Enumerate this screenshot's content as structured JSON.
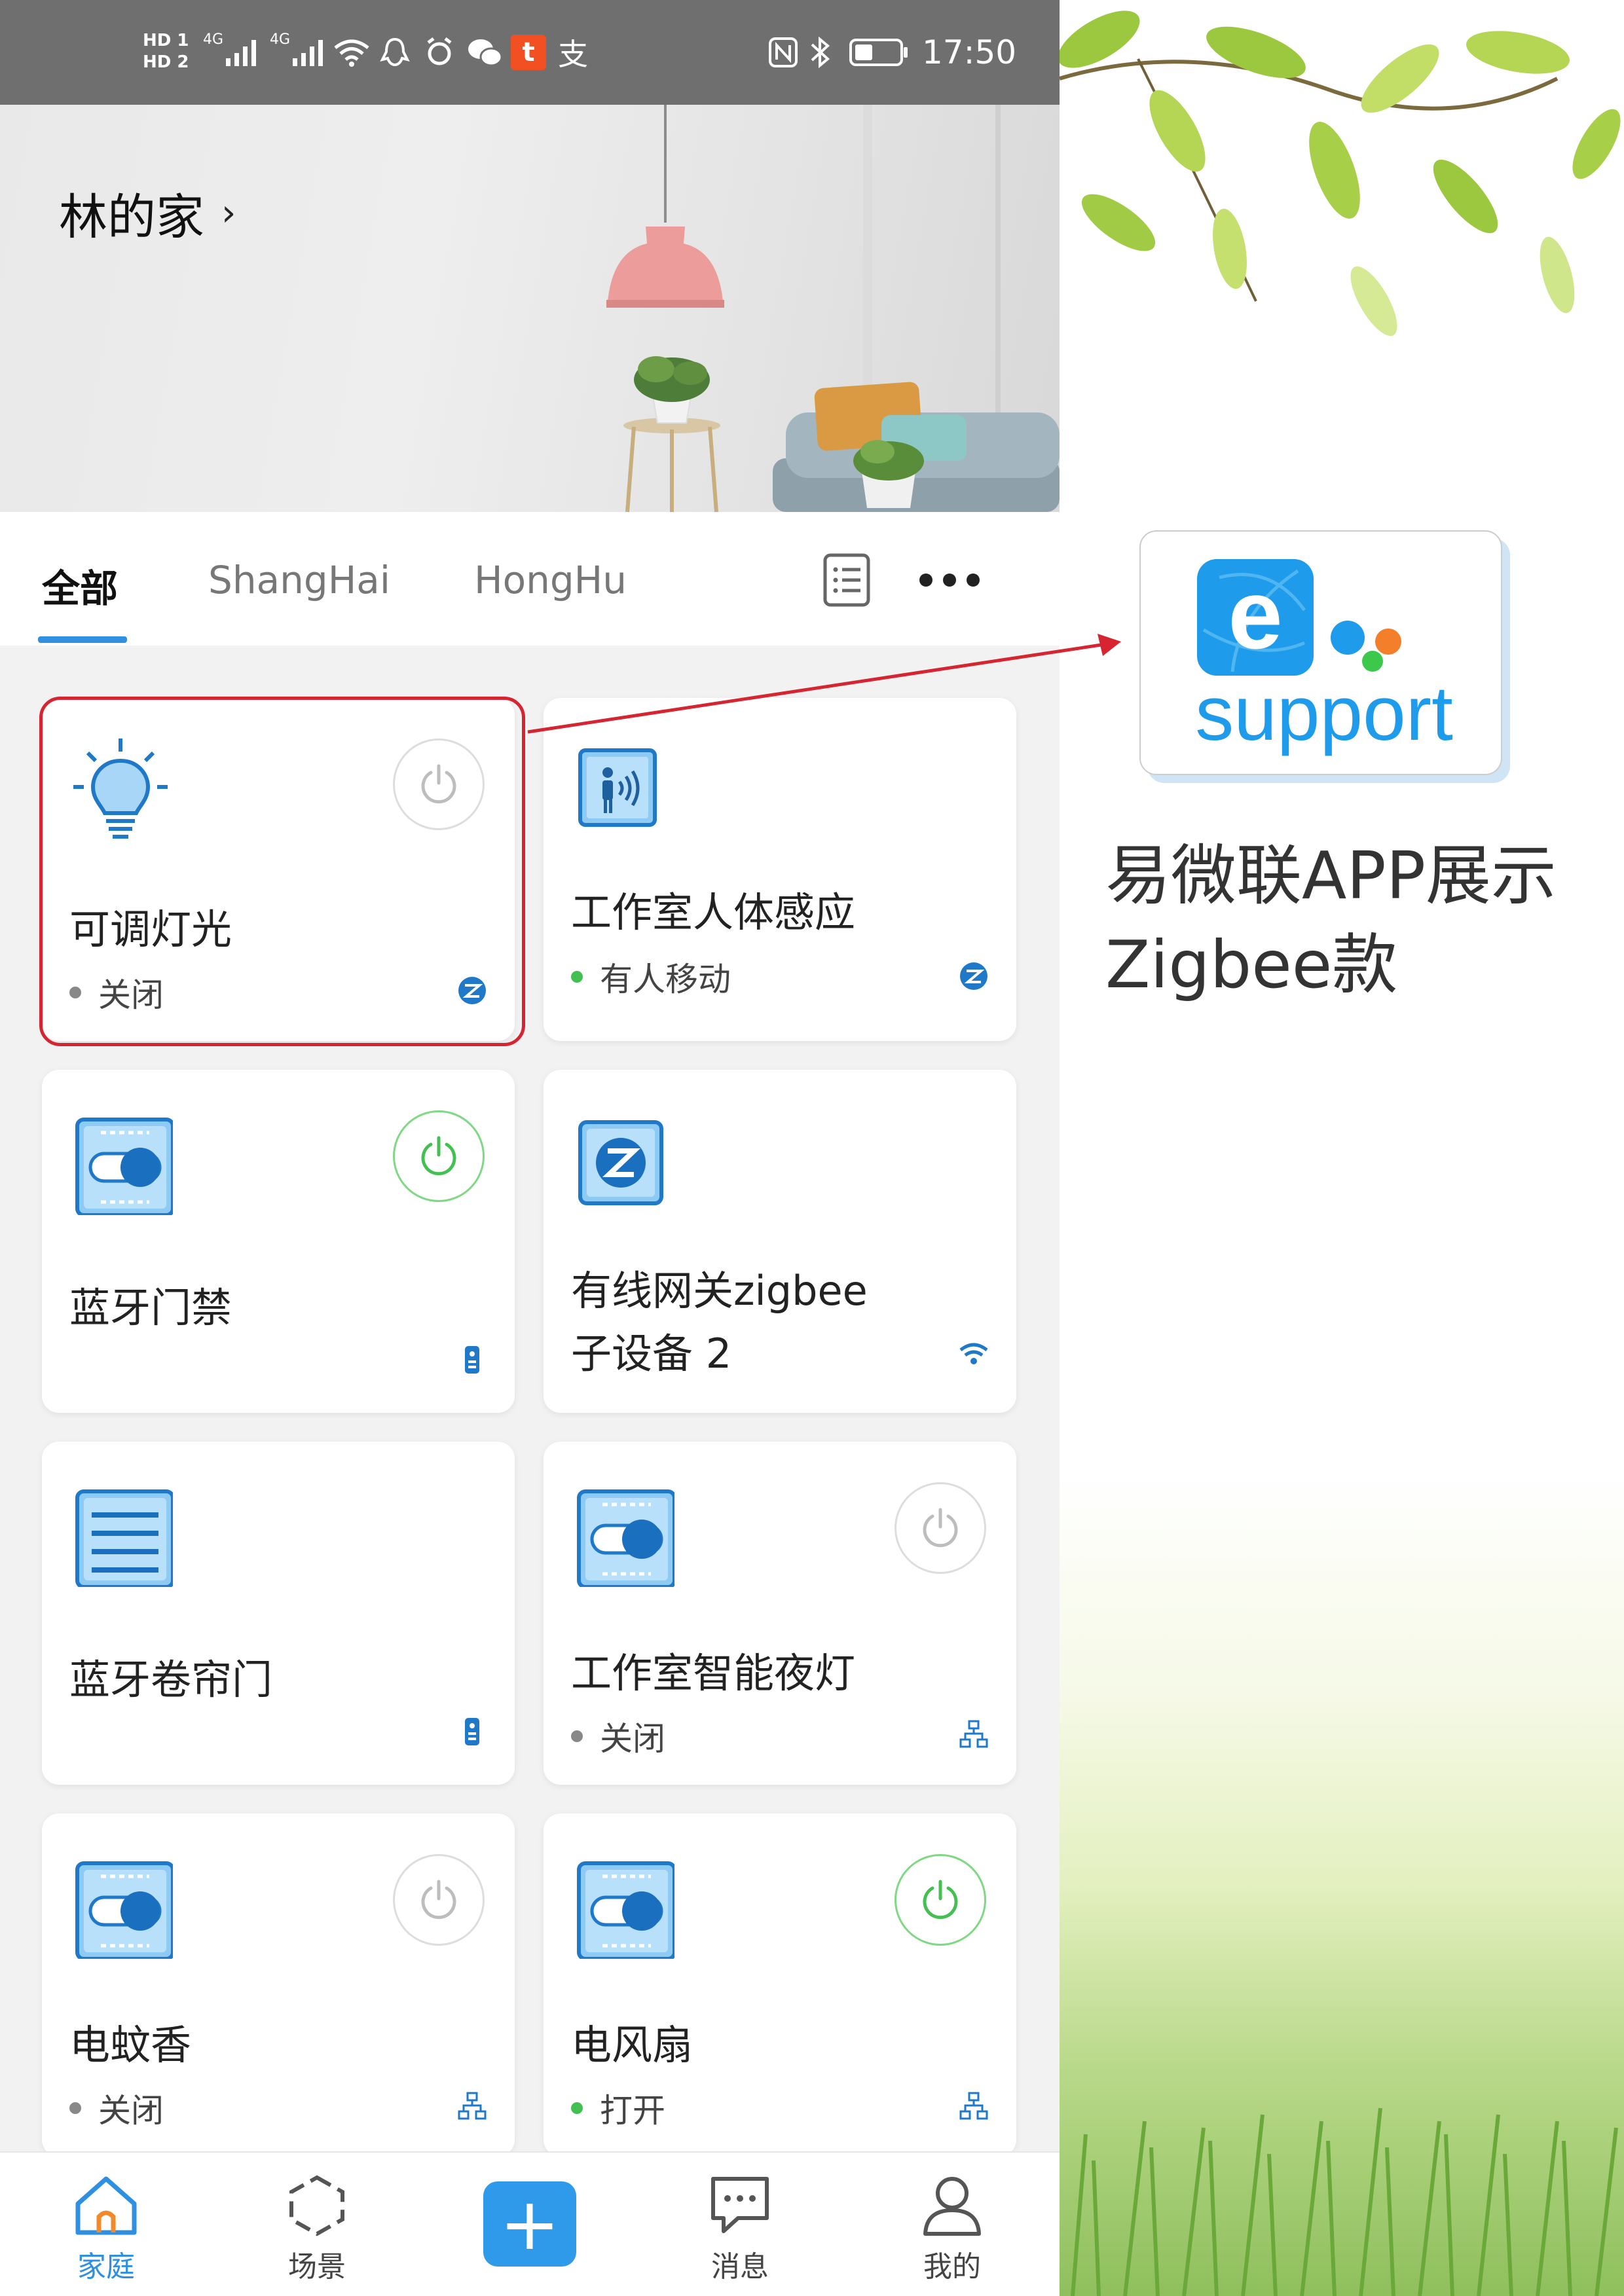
{
  "status_bar": {
    "hd1": "HD 1",
    "hd2": "HD 2",
    "sig1": "4G",
    "sig2": "4G",
    "notif_t": "t",
    "notif_zhi": "支",
    "time": "17:50"
  },
  "header": {
    "home_title": "林的家",
    "chevron": "›"
  },
  "tabs": [
    {
      "label": "全部",
      "active": true
    },
    {
      "label": "ShangHai",
      "active": false
    },
    {
      "label": "HongHu",
      "active": false
    }
  ],
  "devices": [
    {
      "name": "可调灯光",
      "status": "关闭",
      "status_color": "gray",
      "icon": "light-bulb-icon",
      "power": "off",
      "protocol": "zigbee-icon"
    },
    {
      "name": "工作室人体感应",
      "status": "有人移动",
      "status_color": "green",
      "icon": "motion-sensor-icon",
      "power": null,
      "protocol": "zigbee-icon"
    },
    {
      "name": "蓝牙门禁",
      "status": "",
      "icon": "switch-toggle-icon",
      "power": "on",
      "protocol": "bluetooth-device-icon"
    },
    {
      "name": "有线网关zigbee",
      "name2": "子设备 2",
      "status": "",
      "icon": "zigbee-gateway-icon",
      "power": null,
      "protocol": "wifi-icon"
    },
    {
      "name": "蓝牙卷帘门",
      "status": "",
      "icon": "curtain-icon",
      "power": null,
      "protocol": "bluetooth-device-icon"
    },
    {
      "name": "工作室智能夜灯",
      "status": "关闭",
      "status_color": "gray",
      "icon": "switch-toggle-icon",
      "power": "off",
      "protocol": "mesh-icon"
    },
    {
      "name": "电蚊香",
      "status": "关闭",
      "status_color": "gray",
      "icon": "switch-toggle-icon",
      "power": "off",
      "protocol": "mesh-icon"
    },
    {
      "name": "电风扇",
      "status": "打开",
      "status_color": "green",
      "icon": "switch-toggle-icon",
      "power": "on",
      "protocol": "mesh-icon"
    }
  ],
  "bottom_nav": [
    {
      "label": "家庭",
      "icon": "home-icon",
      "active": true
    },
    {
      "label": "场景",
      "icon": "scene-icon",
      "active": false
    },
    {
      "label": "",
      "icon": "plus-icon",
      "active": false
    },
    {
      "label": "消息",
      "icon": "message-icon",
      "active": false
    },
    {
      "label": "我的",
      "icon": "profile-icon",
      "active": false
    }
  ],
  "promo": {
    "logo_e": "e",
    "logo_text": "support",
    "caption": "易微联APP展示\nZigbee款"
  },
  "colors": {
    "accent": "#2f8fe0",
    "highlight": "#d62430",
    "status_bar": "#6f6f6f",
    "on_green": "#44c052"
  }
}
